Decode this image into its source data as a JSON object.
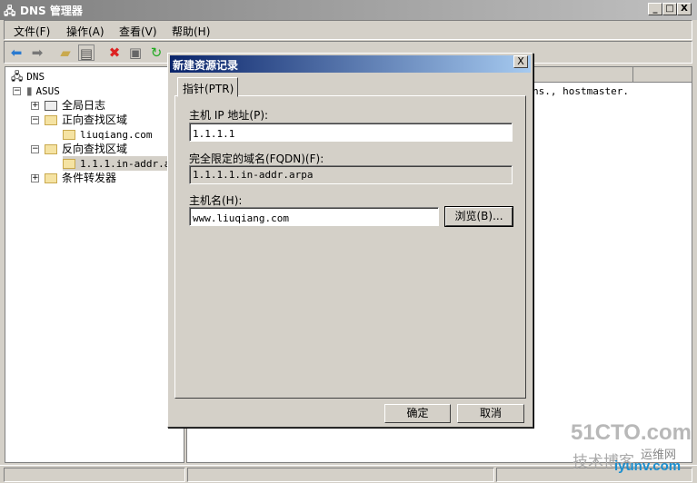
{
  "window": {
    "title": "DNS 管理器",
    "minimize": "_",
    "maximize": "□",
    "close": "X"
  },
  "menu": [
    "文件(F)",
    "操作(A)",
    "查看(V)",
    "帮助(H)"
  ],
  "toolbar": [
    "back-icon",
    "forward-icon",
    "up-folder-icon",
    "show-hide-tree-icon",
    "delete-icon",
    "properties-icon",
    "refresh-icon",
    "export-icon",
    "help-icon",
    "console-icon",
    "server-icon",
    "list-icon",
    "folder-icon"
  ],
  "tree": {
    "root": "DNS",
    "server": "ASUS",
    "global_logs": "全局日志",
    "forward_zones": "正向查找区域",
    "forward_zone_1": "liuqiang.com",
    "reverse_zones": "反向查找区域",
    "reverse_zone_1": "1.1.1.in-addr.ar",
    "conditional_forwarders": "条件转发器"
  },
  "right_pane": {
    "visible_text": "ns., hostmaster."
  },
  "dialog": {
    "title": "新建资源记录",
    "close": "X",
    "tab": "指针(PTR)",
    "ip_label": "主机 IP 地址(P):",
    "ip_value": "1.1.1.1",
    "fqdn_label": "完全限定的域名(FQDN)(F):",
    "fqdn_value": "1.1.1.1.in-addr.arpa",
    "host_label": "主机名(H):",
    "host_value": "www.liuqiang.com",
    "browse": "浏览(B)...",
    "ok": "确定",
    "cancel": "取消"
  },
  "watermark": {
    "line1": "51CTO.com",
    "line2": "技术博客",
    "line3": "运维网",
    "line4": "iyunv.com"
  }
}
